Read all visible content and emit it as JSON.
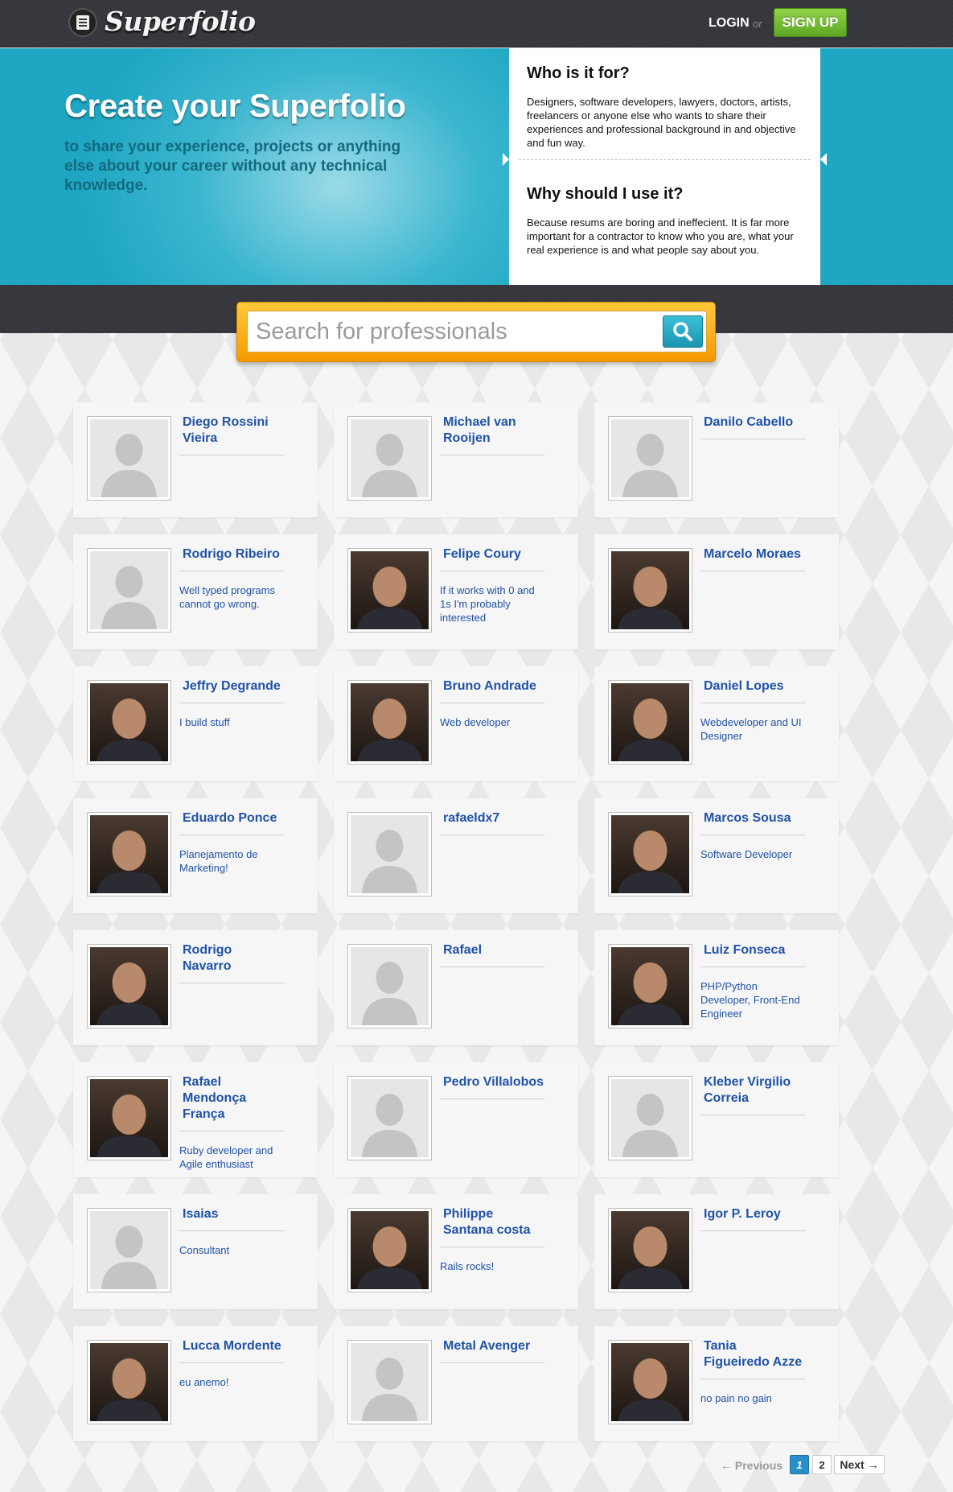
{
  "header": {
    "logo_text": "Superfolio",
    "login": "LOGIN",
    "or": "or",
    "signup": "SIGN UP"
  },
  "hero": {
    "title": "Create your Superfolio",
    "subtitle": "to share your experience, projects or anything else about your career without any technical knowledge.",
    "who_title": "Who is it for?",
    "who_text": "Designers, software developers, lawyers, doctors, artists, freelancers or anyone else who wants to share their experiences and professional background in and objective and fun way.",
    "why_title": "Why should I use it?",
    "why_text": "Because resums are boring and ineffecient. It is far more important for a contractor to know who you are, what your real experience is and what people say about you."
  },
  "search": {
    "placeholder": "Search for professionals"
  },
  "profiles": [
    {
      "name": "Diego Rossini Vieira",
      "bio": "",
      "photo": false
    },
    {
      "name": "Michael van Rooijen",
      "bio": "",
      "photo": false
    },
    {
      "name": "Danilo Cabello",
      "bio": "",
      "photo": false
    },
    {
      "name": "Rodrigo Ribeiro",
      "bio": "Well typed programs cannot go wrong.",
      "photo": false
    },
    {
      "name": "Felipe Coury",
      "bio": "If it works with 0 and 1s I'm probably interested",
      "photo": true
    },
    {
      "name": "Marcelo Moraes",
      "bio": "",
      "photo": true
    },
    {
      "name": "Jeffry Degrande",
      "bio": "I build stuff",
      "photo": true
    },
    {
      "name": "Bruno Andrade",
      "bio": "Web developer",
      "photo": true
    },
    {
      "name": "Daniel Lopes",
      "bio": "Webdeveloper and UI Designer",
      "photo": true
    },
    {
      "name": "Eduardo Ponce",
      "bio": "Planejamento de Marketing!",
      "photo": true
    },
    {
      "name": "rafaeldx7",
      "bio": "",
      "photo": false
    },
    {
      "name": "Marcos Sousa",
      "bio": "Software Developer",
      "photo": true
    },
    {
      "name": "Rodrigo Navarro",
      "bio": "",
      "photo": true
    },
    {
      "name": "Rafael",
      "bio": "",
      "photo": false
    },
    {
      "name": "Luiz Fonseca",
      "bio": "PHP/Python Developer, Front-End Engineer",
      "photo": true
    },
    {
      "name": "Rafael Mendonça França",
      "bio": "Ruby developer and Agile enthusiast",
      "photo": true
    },
    {
      "name": "Pedro Villalobos",
      "bio": "",
      "photo": false
    },
    {
      "name": "Kleber Virgilio Correia",
      "bio": "",
      "photo": false
    },
    {
      "name": "Isaias",
      "bio": "Consultant",
      "photo": false
    },
    {
      "name": "Philippe Santana costa",
      "bio": "Rails rocks!",
      "photo": true
    },
    {
      "name": "Igor P. Leroy",
      "bio": "",
      "photo": true
    },
    {
      "name": "Lucca Mordente",
      "bio": "eu anemo!",
      "photo": true
    },
    {
      "name": "Metal Avenger",
      "bio": "",
      "photo": false
    },
    {
      "name": "Tania Figueiredo Azze",
      "bio": "no pain no gain",
      "photo": true
    }
  ],
  "pagination": {
    "previous": "← Previous",
    "pages": [
      "1",
      "2"
    ],
    "current": "1",
    "next": "Next →"
  },
  "colors": {
    "accent": "#1ea6c2",
    "link": "#1f52a8",
    "signup": "#6bb52e",
    "search_frame": "#f5a90f"
  }
}
